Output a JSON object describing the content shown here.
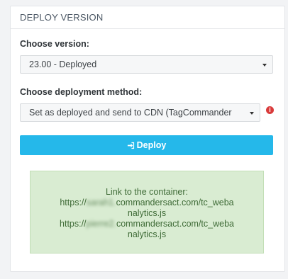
{
  "panel": {
    "title": "DEPLOY VERSION"
  },
  "version": {
    "label": "Choose version:",
    "selected": "23.00 - Deployed"
  },
  "method": {
    "label": "Choose deployment method:",
    "selected": "Set as deployed and send to CDN (TagCommander"
  },
  "deploy_button": {
    "label": "Deploy"
  },
  "container_links": {
    "heading": "Link to the container:",
    "link1_prefix": "https://",
    "link1_blurred": "sarah1.",
    "link1_suffix_a": "commandersact.com/tc_weba",
    "link1_suffix_b": "nalytics.js",
    "link2_prefix": "https://",
    "link2_blurred": "pierre2.",
    "link2_suffix_a": "commandersact.com/tc_weba",
    "link2_suffix_b": "nalytics.js"
  },
  "colors": {
    "accent": "#25b8ea",
    "success_bg": "#d9ecd2",
    "info_icon": "#d93a3a"
  }
}
